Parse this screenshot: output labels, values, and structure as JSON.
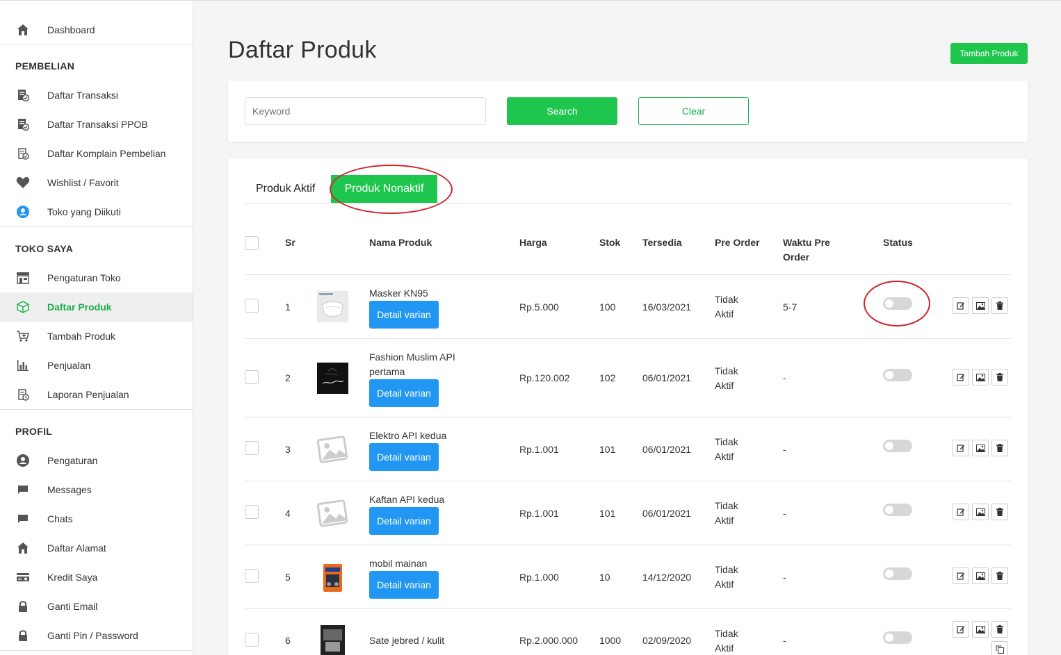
{
  "sidebar": {
    "dashboard": "Dashboard",
    "pembelian_header": "PEMBELIAN",
    "pembelian_items": [
      "Daftar Transaksi",
      "Daftar Transaksi PPOB",
      "Daftar Komplain Pembelian",
      "Wishlist / Favorit",
      "Toko yang Diikuti"
    ],
    "toko_header": "TOKO SAYA",
    "toko_items": [
      "Pengaturan Toko",
      "Daftar Produk",
      "Tambah Produk",
      "Penjualan",
      "Laporan Penjualan"
    ],
    "profil_header": "PROFIL",
    "profil_items": [
      "Pengaturan",
      "Messages",
      "Chats",
      "Daftar Alamat",
      "Kredit Saya",
      "Ganti Email",
      "Ganti Pin / Password"
    ]
  },
  "page": {
    "title": "Daftar Produk",
    "add_button": "Tambah Produk"
  },
  "search": {
    "placeholder": "Keyword",
    "search_button": "Search",
    "clear_button": "Clear"
  },
  "tabs": {
    "active": "Produk Aktif",
    "inactive": "Produk Nonaktif"
  },
  "table": {
    "headers": {
      "sr": "Sr",
      "name": "Nama Produk",
      "price": "Harga",
      "stock": "Stok",
      "available": "Tersedia",
      "preorder": "Pre Order",
      "preorder_time_1": "Waktu Pre",
      "preorder_time_2": "Order",
      "status": "Status"
    },
    "detail_button": "Detail varian",
    "rows": [
      {
        "sr": "1",
        "name": "Masker KN95",
        "name2": "",
        "price": "Rp.5.000",
        "stock": "100",
        "date": "16/03/2021",
        "po1": "Tidak",
        "po2": "Aktif",
        "pot": "5-7"
      },
      {
        "sr": "2",
        "name": "Fashion Muslim API",
        "name2": "pertama",
        "price": "Rp.120.002",
        "stock": "102",
        "date": "06/01/2021",
        "po1": "Tidak",
        "po2": "Aktif",
        "pot": "-"
      },
      {
        "sr": "3",
        "name": "Elektro API kedua",
        "name2": "",
        "price": "Rp.1.001",
        "stock": "101",
        "date": "06/01/2021",
        "po1": "Tidak",
        "po2": "Aktif",
        "pot": "-"
      },
      {
        "sr": "4",
        "name": "Kaftan API kedua",
        "name2": "",
        "price": "Rp.1.001",
        "stock": "101",
        "date": "06/01/2021",
        "po1": "Tidak",
        "po2": "Aktif",
        "pot": "-"
      },
      {
        "sr": "5",
        "name": "mobil mainan",
        "name2": "",
        "price": "Rp.1.000",
        "stock": "10",
        "date": "14/12/2020",
        "po1": "Tidak",
        "po2": "Aktif",
        "pot": "-"
      },
      {
        "sr": "6",
        "name": "Sate jebred / kulit",
        "name2": "",
        "price": "Rp.2.000.000",
        "stock": "1000",
        "date": "02/09/2020",
        "po1": "Tidak",
        "po2": "Aktif",
        "pot": "-"
      }
    ]
  },
  "colors": {
    "accent_green": "#1ec64e",
    "detail_blue": "#2196f3",
    "annotation_red": "#d0242c"
  }
}
